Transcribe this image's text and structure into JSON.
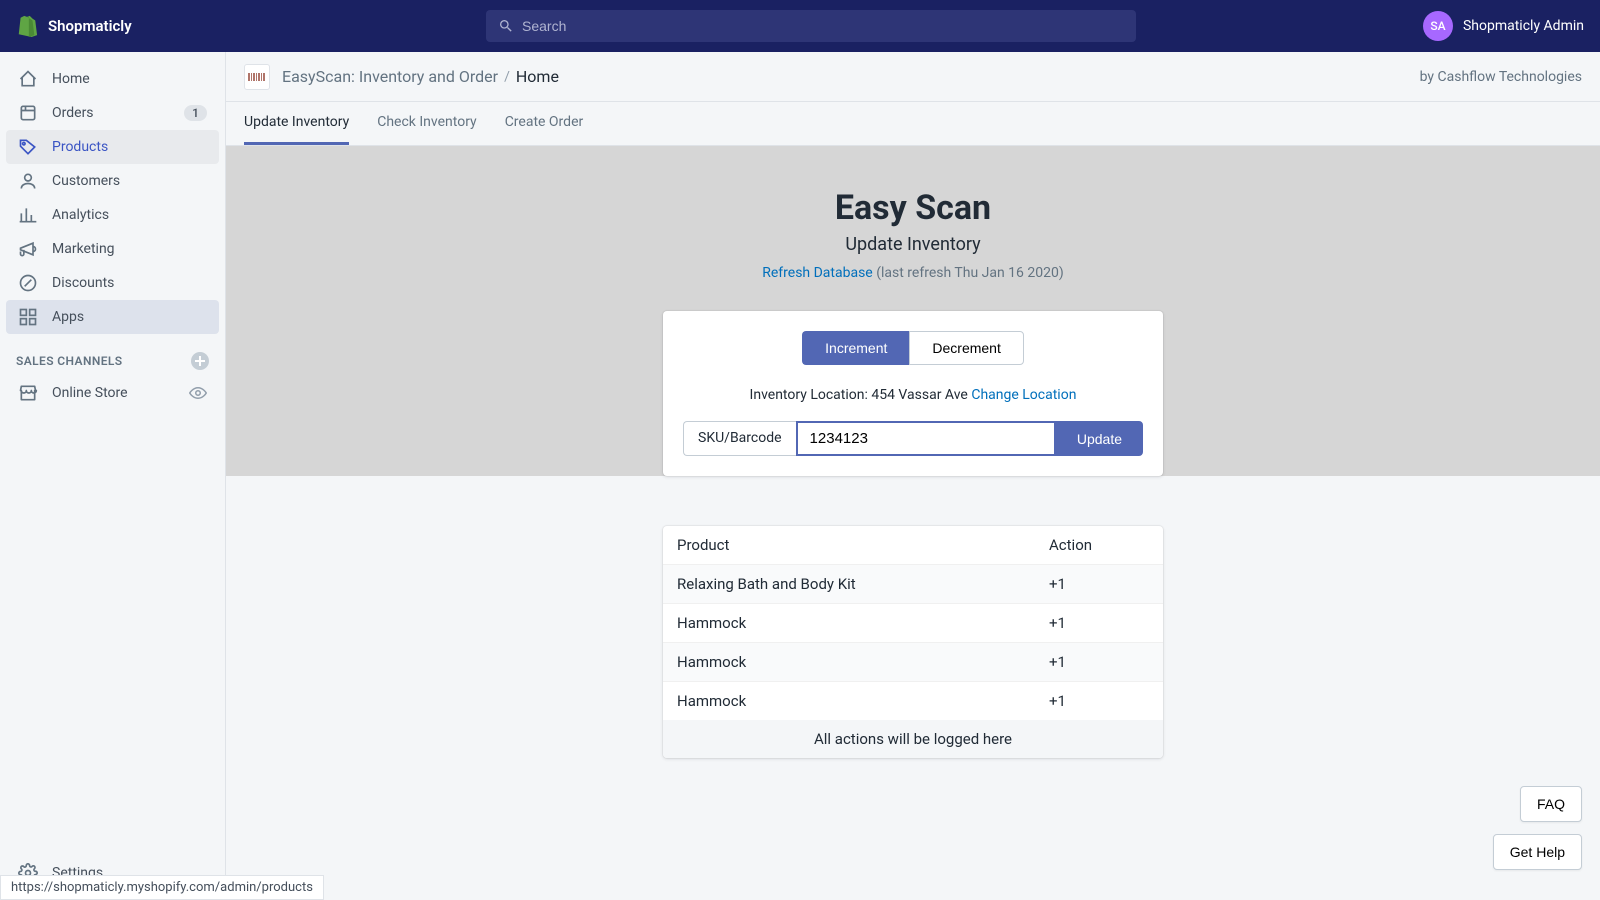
{
  "topbar": {
    "brand": "Shopmaticly",
    "search_placeholder": "Search",
    "avatar_initials": "SA",
    "admin_name": "Shopmaticly Admin"
  },
  "sidebar": {
    "items": [
      {
        "label": "Home",
        "icon": "home"
      },
      {
        "label": "Orders",
        "icon": "orders",
        "badge": "1"
      },
      {
        "label": "Products",
        "icon": "tag",
        "active": true
      },
      {
        "label": "Customers",
        "icon": "person"
      },
      {
        "label": "Analytics",
        "icon": "bars"
      },
      {
        "label": "Marketing",
        "icon": "megaphone"
      },
      {
        "label": "Discounts",
        "icon": "discount"
      },
      {
        "label": "Apps",
        "icon": "apps",
        "highlighted": true
      }
    ],
    "section_label": "SALES CHANNELS",
    "channels": [
      {
        "label": "Online Store",
        "icon": "store"
      }
    ],
    "settings_label": "Settings"
  },
  "breadcrumb": {
    "app_name": "EasyScan: Inventory and Order",
    "page": "Home",
    "by_line": "by Cashflow Technologies"
  },
  "tabs": [
    {
      "label": "Update Inventory",
      "active": true
    },
    {
      "label": "Check Inventory"
    },
    {
      "label": "Create Order"
    }
  ],
  "hero": {
    "title": "Easy Scan",
    "subtitle": "Update Inventory",
    "refresh_link": "Refresh Database",
    "refresh_meta": "(last refresh Thu Jan 16 2020)"
  },
  "scan_card": {
    "toggle_inc": "Increment",
    "toggle_dec": "Decrement",
    "location_label": "Inventory Location: ",
    "location_value": "454 Vassar Ave ",
    "change_location": "Change Location",
    "input_label": "SKU/Barcode",
    "input_value": "1234123",
    "update_btn": "Update"
  },
  "log_table": {
    "col_product": "Product",
    "col_action": "Action",
    "rows": [
      {
        "product": "Relaxing Bath and Body Kit",
        "action": "+1"
      },
      {
        "product": "Hammock",
        "action": "+1"
      },
      {
        "product": "Hammock",
        "action": "+1"
      },
      {
        "product": "Hammock",
        "action": "+1"
      }
    ],
    "footer": "All actions will be logged here"
  },
  "help": {
    "faq": "FAQ",
    "get_help": "Get Help"
  },
  "statusbar": "https://shopmaticly.myshopify.com/admin/products"
}
